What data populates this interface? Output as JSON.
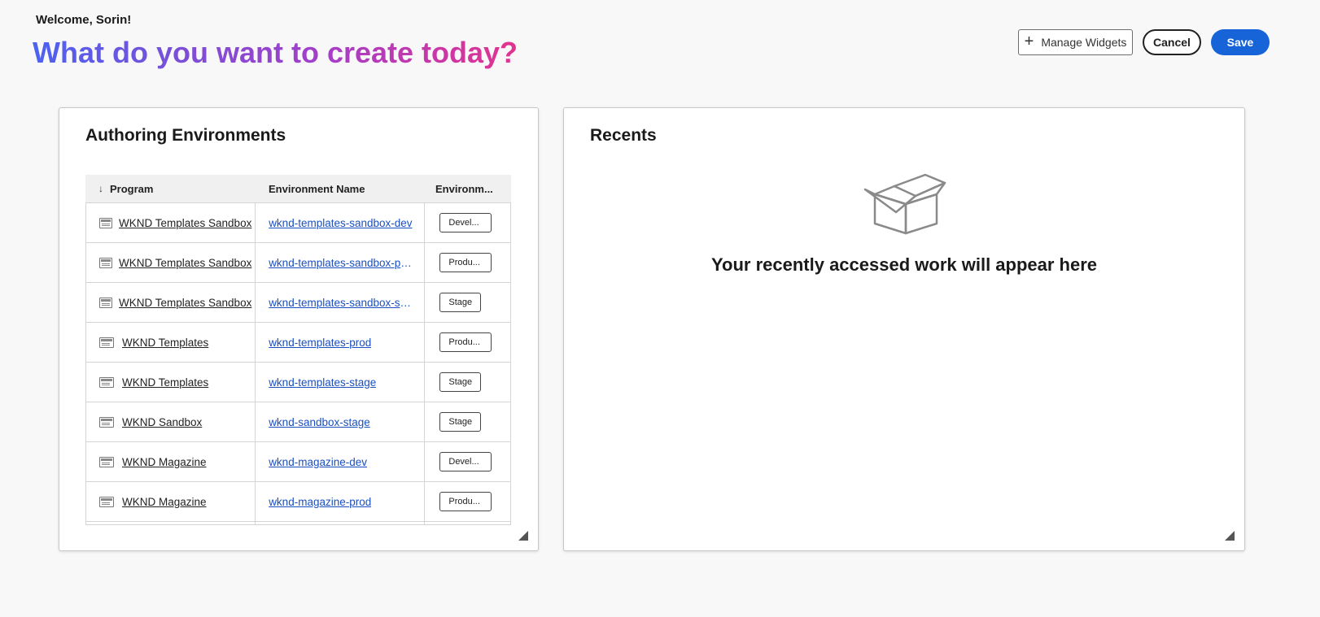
{
  "header": {
    "welcome": "Welcome, Sorin!",
    "headline": "What do you want to create today?",
    "manage_widgets_label": "Manage Widgets",
    "cancel_label": "Cancel",
    "save_label": "Save"
  },
  "colors": {
    "accent_blue": "#1764d8",
    "link_blue": "#1a4fc0",
    "gradient": [
      "#4c62f0",
      "#7a4fd8",
      "#a43ec8",
      "#e2338f"
    ]
  },
  "authoring": {
    "title": "Authoring Environments",
    "columns": {
      "program": "Program",
      "environment_name": "Environment Name",
      "environment_type": "Environm..."
    },
    "rows": [
      {
        "program": "WKND Templates Sandbox",
        "env": "wknd-templates-sandbox-dev",
        "type": "Devel..."
      },
      {
        "program": "WKND Templates Sandbox",
        "env": "wknd-templates-sandbox-prod",
        "type": "Produ..."
      },
      {
        "program": "WKND Templates Sandbox",
        "env": "wknd-templates-sandbox-sta...",
        "type": "Stage"
      },
      {
        "program": "WKND Templates",
        "env": "wknd-templates-prod",
        "type": "Produ..."
      },
      {
        "program": "WKND Templates",
        "env": "wknd-templates-stage",
        "type": "Stage"
      },
      {
        "program": "WKND Sandbox",
        "env": "wknd-sandbox-stage",
        "type": "Stage"
      },
      {
        "program": "WKND Magazine",
        "env": "wknd-magazine-dev",
        "type": "Devel..."
      },
      {
        "program": "WKND Magazine",
        "env": "wknd-magazine-prod",
        "type": "Produ..."
      }
    ]
  },
  "recents": {
    "title": "Recents",
    "empty_message": "Your recently accessed work will appear here",
    "empty_icon": "open-box-icon"
  }
}
